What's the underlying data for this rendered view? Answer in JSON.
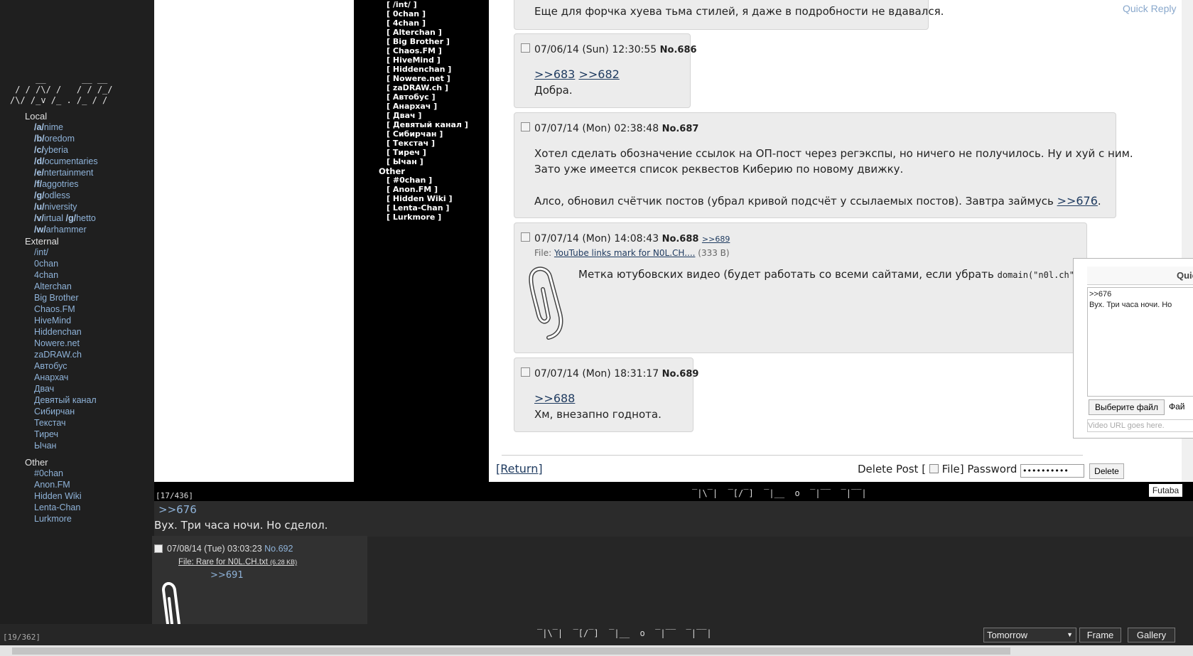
{
  "sidebar": {
    "logo": "     __       __ __\n / / /\\/ /   / / /_/\n/\\/ /_v /_ . /_ / /",
    "sections": {
      "local": "Local",
      "external": "External",
      "other": "Other"
    },
    "local_boards": [
      {
        "code": "/a/",
        "rest": "nime"
      },
      {
        "code": "/b/",
        "rest": "oredom"
      },
      {
        "code": "/c/",
        "rest": "yberia"
      },
      {
        "code": "/d/",
        "rest": "ocumentaries"
      },
      {
        "code": "/e/",
        "rest": "ntertainment"
      },
      {
        "code": "/f/",
        "rest": "aggotries"
      },
      {
        "code": "/g/",
        "rest": "odless"
      },
      {
        "code": "/u/",
        "rest": "niversity"
      },
      {
        "code": "/v/",
        "rest": "irtual",
        "code2": "/g/",
        "rest2": "hetto"
      },
      {
        "code": "/w/",
        "rest": "arhammer"
      }
    ],
    "external_boards": [
      "/int/",
      "0chan",
      "4chan",
      "Alterchan",
      "Big Brother",
      "Chaos.FM",
      "HiveMind",
      "Hiddenchan",
      "Nowere.net",
      "zaDRAW.ch",
      "Автобус",
      "Анархач",
      "Двач",
      "Девятый канал",
      "Сибирчан",
      "Текстач",
      "Тиреч",
      "Ычан"
    ],
    "other_boards": [
      "#0chan",
      "Anon.FM",
      "Hidden Wiki",
      "Lenta-Chan",
      "Lurkmore"
    ]
  },
  "black_frame": {
    "external_items": [
      "[ /int/ ]",
      "[ 0chan ]",
      "[ 4chan ]",
      "[ Alterchan ]",
      "[ Big Brother ]",
      "[ Chaos.FM ]",
      "[ HiveMind ]",
      "[ Hiddenchan ]",
      "[ Nowere.net ]",
      "[ zaDRAW.ch ]",
      "[ Автобус ]",
      "[ Анархач ]",
      "[ Двач ]",
      "[ Девятый канал ]",
      "[ Сибирчан ]",
      "[ Текстач ]",
      "[ Тиреч ]",
      "[ Ычан ]"
    ],
    "other_label": "Other",
    "other_items": [
      "[ #0chan ]",
      "[ Anon.FM ]",
      "[ Hidden Wiki ]",
      "[ Lenta-Chan ]",
      "[ Lurkmore ]"
    ]
  },
  "thread": {
    "quick_reply_link": "Quick Reply",
    "post_top_text": "Еще для форчка хуева тьма стилей, я даже в подробности не вдавался.",
    "posts": [
      {
        "date": "07/06/14 (Sun) 12:30:55",
        "no": "No.686",
        "links": [
          ">>683",
          ">>682"
        ],
        "line1": "Добра."
      },
      {
        "date": "07/07/14 (Mon) 02:38:48",
        "no": "No.687",
        "line1": "Хотел сделать обозначение ссылок на ОП-пост через регэкспы, но ничего не получилось. Ну и хуй с ним.",
        "line2": "Зато уже имеется список реквестов Киберию по новому движку.",
        "line3": "Алсо, обновил счётчик постов (убрал кривой подсчёт у ссылаемых постов). Завтра займусь ",
        "line3_link": ">>676",
        "line3_end": "."
      },
      {
        "date": "07/07/14 (Mon) 14:08:43",
        "no": "No.688",
        "backlink": ">>689",
        "file_label": "File: ",
        "file_name": "YouTube links mark for N0L.CH....",
        "file_size": "(333 B)",
        "body_pre": "Метка ютубовских видео (будет работать со всеми сайтами, если убрать ",
        "body_code": "domain(\"n0l.ch\")",
        "body_post": ")."
      },
      {
        "date": "07/07/14 (Mon) 18:31:17",
        "no": "No.689",
        "links": [
          ">>688"
        ],
        "line1": "Хм, внезапно годнота."
      }
    ],
    "return_link": "[Return]",
    "delete_label": "Delete Post [",
    "file_only_label": "File] Password",
    "password_value": "••••••••••",
    "delete_button": "Delete"
  },
  "quick_reply": {
    "title": "Quic",
    "text_line1": ">>676",
    "text_line2": "Вух. Три часа ночи. Но",
    "choose_file": "Выберите файл",
    "file_status": "Фай",
    "video_placeholder": "Video URL goes here."
  },
  "viewer": {
    "counter_top": "[17/436]",
    "strip_logo": "‾|\\‾|  ‾[/‾]  ‾|__  o  ‾|‾‾  ‾|‾‾|",
    "futaba": "Futaba",
    "reply_link": ">>676",
    "reply_text": "Вух. Три часа ночи. Но сделол.",
    "post692": {
      "date": "07/08/14 (Tue) 03:03:23",
      "no": "No.692",
      "file_label": "File: ",
      "file_name": "Rare for N0L.CH.txt",
      "file_size": "(6.28 KB)",
      "link": ">>691"
    },
    "counter_bottom": "[19/362]",
    "bottom_logo": "‾|\\‾|  ‾[/‾]  ‾|__  o  ‾|‾‾  ‾|‾‾|",
    "tomorrow_select": "Tomorrow",
    "frame_button": "Frame",
    "gallery_button": "Gallery"
  },
  "colors": {
    "sidebar_bg": "#1f1f1f",
    "sidebar_link": "#8fb3d9",
    "post_bg": "#ececec",
    "link": "#1e3a5f"
  }
}
